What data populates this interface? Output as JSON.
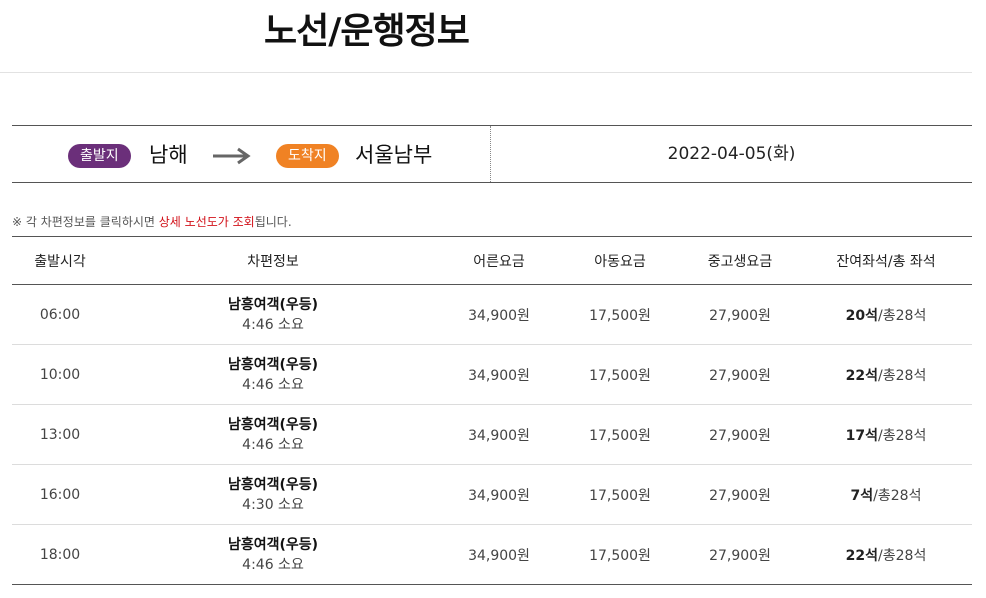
{
  "page": {
    "title": "노선/운행정보"
  },
  "route": {
    "departure_badge": "출발지",
    "departure_city": "남해",
    "arrival_badge": "도착지",
    "arrival_city": "서울남부",
    "date": "2022-04-05(화)",
    "colors": {
      "departure_badge": "#6b2f7a",
      "arrival_badge": "#f08224"
    },
    "arrow_icon": "right-arrow-icon"
  },
  "notice": {
    "prefix": "※ 각 차편정보를 클릭하시면 ",
    "highlight": "상세 노선도가 조회",
    "suffix": "됩니다.",
    "highlight_color": "#d2121a"
  },
  "table": {
    "headers": [
      "출발시각",
      "차편정보",
      "어른요금",
      "아동요금",
      "중고생요금",
      "잔여좌석/총 좌석"
    ],
    "rows": [
      {
        "time": "06:00",
        "bus": "남흥여객(우등)",
        "duration": "4:46 소요",
        "adult": "34,900원",
        "child": "17,500원",
        "student": "27,900원",
        "seats_left": "20석",
        "seats_total": "/총28석"
      },
      {
        "time": "10:00",
        "bus": "남흥여객(우등)",
        "duration": "4:46 소요",
        "adult": "34,900원",
        "child": "17,500원",
        "student": "27,900원",
        "seats_left": "22석",
        "seats_total": "/총28석"
      },
      {
        "time": "13:00",
        "bus": "남흥여객(우등)",
        "duration": "4:46 소요",
        "adult": "34,900원",
        "child": "17,500원",
        "student": "27,900원",
        "seats_left": "17석",
        "seats_total": "/총28석"
      },
      {
        "time": "16:00",
        "bus": "남흥여객(우등)",
        "duration": "4:30 소요",
        "adult": "34,900원",
        "child": "17,500원",
        "student": "27,900원",
        "seats_left": "7석",
        "seats_total": "/총28석"
      },
      {
        "time": "18:00",
        "bus": "남흥여객(우등)",
        "duration": "4:46 소요",
        "adult": "34,900원",
        "child": "17,500원",
        "student": "27,900원",
        "seats_left": "22석",
        "seats_total": "/총28석"
      }
    ]
  }
}
